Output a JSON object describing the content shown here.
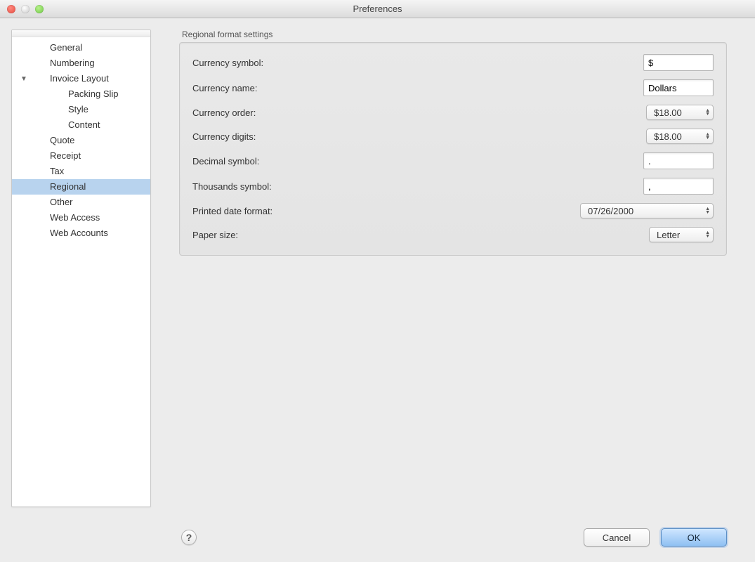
{
  "window": {
    "title": "Preferences"
  },
  "sidebar": {
    "items": [
      {
        "label": "General"
      },
      {
        "label": "Numbering"
      },
      {
        "label": "Invoice Layout",
        "expanded": true
      },
      {
        "label": "Packing Slip"
      },
      {
        "label": "Style"
      },
      {
        "label": "Content"
      },
      {
        "label": "Quote"
      },
      {
        "label": "Receipt"
      },
      {
        "label": "Tax"
      },
      {
        "label": "Regional",
        "selected": true
      },
      {
        "label": "Other"
      },
      {
        "label": "Web Access"
      },
      {
        "label": "Web Accounts"
      }
    ]
  },
  "group": {
    "title": "Regional format settings"
  },
  "form": {
    "currency_symbol": {
      "label": "Currency symbol:",
      "value": "$"
    },
    "currency_name": {
      "label": "Currency name:",
      "value": "Dollars"
    },
    "currency_order": {
      "label": "Currency order:",
      "value": "$18.00"
    },
    "currency_digits": {
      "label": "Currency digits:",
      "value": "$18.00"
    },
    "decimal_symbol": {
      "label": "Decimal symbol:",
      "value": "."
    },
    "thousands_symbol": {
      "label": "Thousands symbol:",
      "value": ","
    },
    "date_format": {
      "label": "Printed date format:",
      "value": "07/26/2000"
    },
    "paper_size": {
      "label": "Paper size:",
      "value": "Letter"
    }
  },
  "footer": {
    "help": "?",
    "cancel": "Cancel",
    "ok": "OK"
  }
}
